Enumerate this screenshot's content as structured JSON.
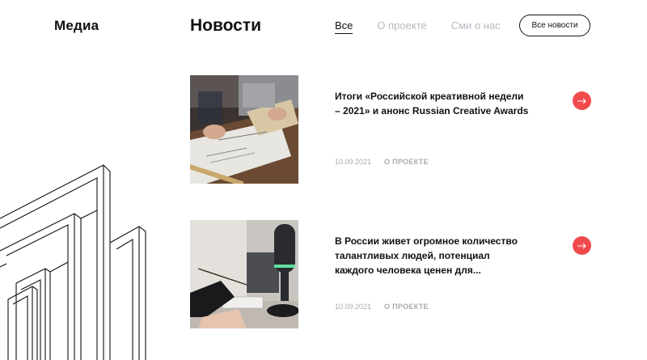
{
  "header": {
    "section_label": "Медиа",
    "page_title": "Новости",
    "tabs": [
      {
        "label": "Все",
        "active": true
      },
      {
        "label": "О проекте",
        "active": false
      },
      {
        "label": "Сми о нас",
        "active": false
      }
    ],
    "all_news_button": "Все новости"
  },
  "colors": {
    "accent": "#f04a4d",
    "muted": "#b7b9c0",
    "text": "#111111"
  },
  "news": [
    {
      "title": "Итоги «Российской креативной недели – 2021» и анонс Russian Creative Awards",
      "date": "10.09.2021",
      "tag": "О ПРОЕКТЕ",
      "image_icon": "architect-drawing-photo"
    },
    {
      "title": "В России живет огромное количество талантливых людей, потенциал каждого человека ценен для...",
      "date": "10.09.2021",
      "tag": "О ПРОЕКТЕ",
      "image_icon": "microphone-podcast-photo"
    }
  ]
}
